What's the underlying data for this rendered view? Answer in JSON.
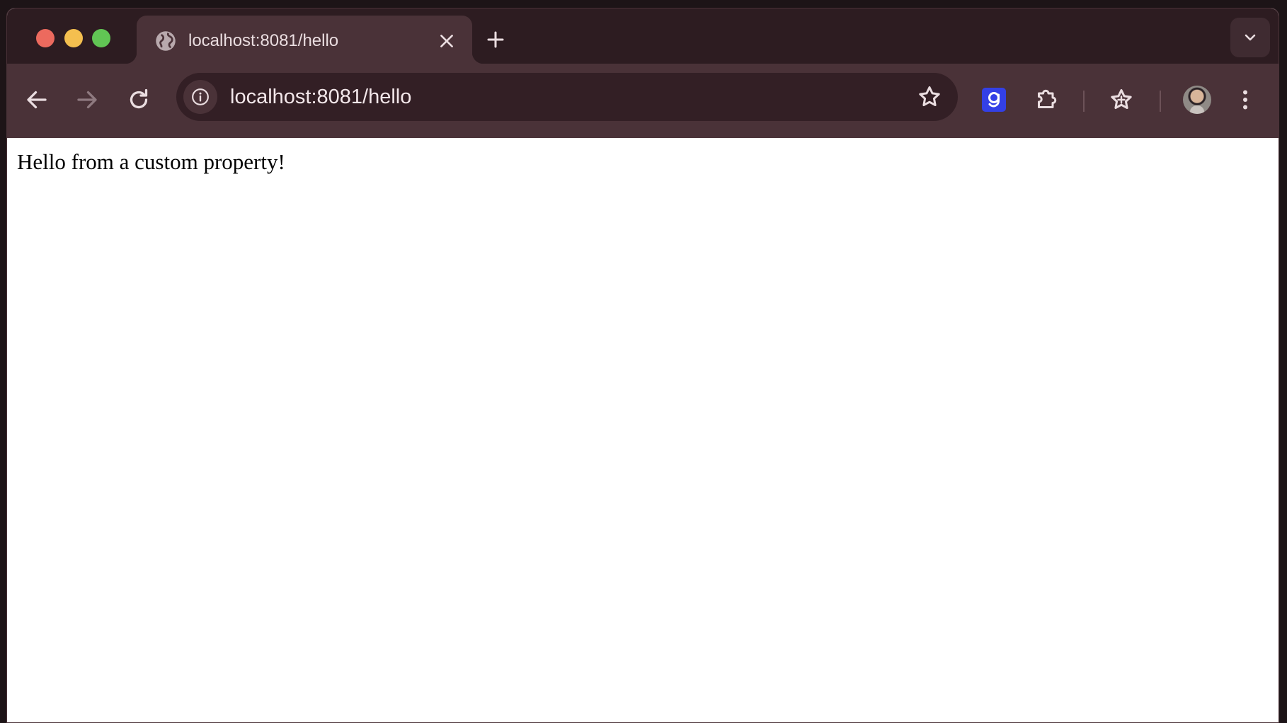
{
  "browser": {
    "tab": {
      "title": "localhost:8081/hello"
    },
    "omnibox": {
      "url": "localhost:8081/hello"
    },
    "icons": {
      "favicon": "globe-icon",
      "tab_close": "close-icon",
      "new_tab": "plus-icon",
      "tab_search": "chevron-down-icon",
      "back": "arrow-left-icon",
      "forward": "arrow-right-icon",
      "reload": "reload-icon",
      "site_info": "info-icon",
      "bookmark": "star-icon",
      "extension": "g-extension-icon",
      "extensions": "puzzle-icon",
      "reading_list": "star-sparkle-icon",
      "profile": "avatar",
      "menu": "kebab-menu-icon"
    },
    "colors": {
      "frame": "#2d1c21",
      "toolbar": "#4a3238",
      "omnibox": "#331f25",
      "close": "#ec6a5e",
      "minimize": "#f4bf4f",
      "maximize": "#61c554",
      "extension_accent": "#3340e6"
    }
  },
  "page": {
    "text": "Hello from a custom property!"
  }
}
